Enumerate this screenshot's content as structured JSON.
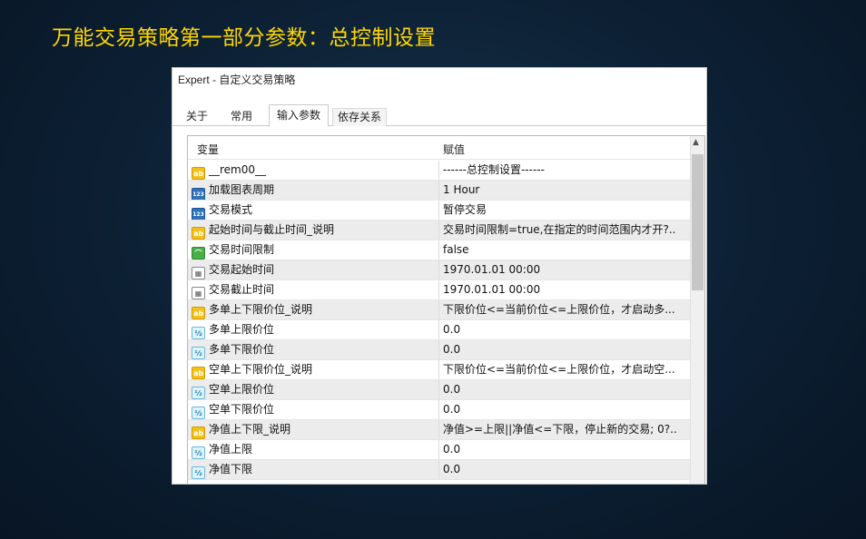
{
  "headline": "万能交易策略第一部分参数：总控制设置",
  "window": {
    "title": "Expert - 自定义交易策略"
  },
  "tabs": [
    {
      "label": "关于"
    },
    {
      "label": "常用"
    },
    {
      "label": "输入参数"
    },
    {
      "label": "依存关系"
    }
  ],
  "grid": {
    "columns": [
      "变量",
      "赋值"
    ],
    "rows": [
      {
        "icon": "ab",
        "icon_text": "ab",
        "name": "__rem00__",
        "value": "------总控制设置------"
      },
      {
        "icon": "n123",
        "icon_text": "123",
        "name": "加载图表周期",
        "value": "1 Hour"
      },
      {
        "icon": "n123",
        "icon_text": "123",
        "name": "交易模式",
        "value": "暂停交易"
      },
      {
        "icon": "ab",
        "icon_text": "ab",
        "name": "起始时间与截止时间_说明",
        "value": "交易时间限制=true,在指定的时间范围内才开?.."
      },
      {
        "icon": "bool",
        "icon_text": "⌒",
        "name": "交易时间限制",
        "value": "false"
      },
      {
        "icon": "dt",
        "icon_text": "▦",
        "name": "交易起始时间",
        "value": "1970.01.01 00:00"
      },
      {
        "icon": "dt",
        "icon_text": "▦",
        "name": "交易截止时间",
        "value": "1970.01.01 00:00"
      },
      {
        "icon": "ab",
        "icon_text": "ab",
        "name": "多单上下限价位_说明",
        "value": "下限价位<=当前价位<=上限价位，才启动多..."
      },
      {
        "icon": "dbl",
        "icon_text": "½",
        "name": "多单上限价位",
        "value": "0.0"
      },
      {
        "icon": "dbl",
        "icon_text": "½",
        "name": "多单下限价位",
        "value": "0.0"
      },
      {
        "icon": "ab",
        "icon_text": "ab",
        "name": "空单上下限价位_说明",
        "value": "下限价位<=当前价位<=上限价位，才启动空..."
      },
      {
        "icon": "dbl",
        "icon_text": "½",
        "name": "空单上限价位",
        "value": "0.0"
      },
      {
        "icon": "dbl",
        "icon_text": "½",
        "name": "空单下限价位",
        "value": "0.0"
      },
      {
        "icon": "ab",
        "icon_text": "ab",
        "name": "净值上下限_说明",
        "value": "净值>=上限||净值<=下限，停止新的交易; 0?.."
      },
      {
        "icon": "dbl",
        "icon_text": "½",
        "name": "净值上限",
        "value": "0.0"
      },
      {
        "icon": "dbl",
        "icon_text": "½",
        "name": "净值下限",
        "value": "0.0"
      }
    ]
  }
}
